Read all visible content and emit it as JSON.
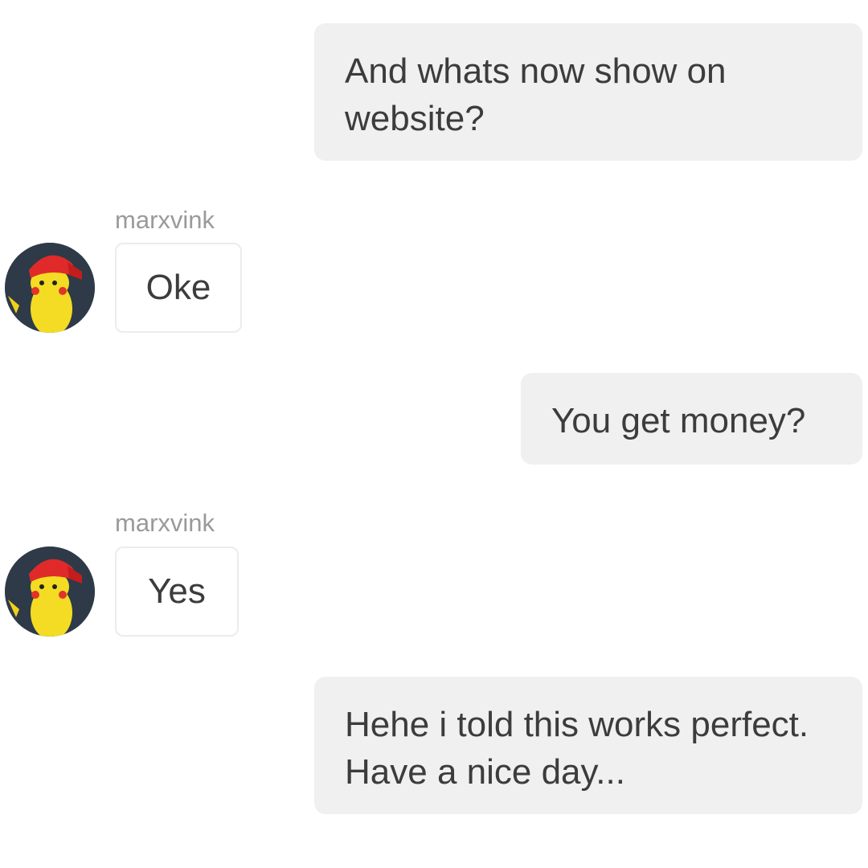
{
  "messages": [
    {
      "direction": "outgoing",
      "text": "And whats now show on website?"
    },
    {
      "direction": "incoming",
      "sender": "marxvink",
      "text": "Oke",
      "avatar_icon": "pikachu-avatar-icon"
    },
    {
      "direction": "outgoing",
      "text": "You get money?"
    },
    {
      "direction": "incoming",
      "sender": "marxvink",
      "text": "Yes",
      "avatar_icon": "pikachu-avatar-icon"
    },
    {
      "direction": "outgoing",
      "text": "Hehe i told this works perfect. Have a nice day..."
    }
  ],
  "colors": {
    "outgoing_bubble": "#eff0ef",
    "incoming_bubble_border": "#ececec",
    "message_text": "#3c3c3c",
    "sender_text": "#9a9a9a"
  }
}
